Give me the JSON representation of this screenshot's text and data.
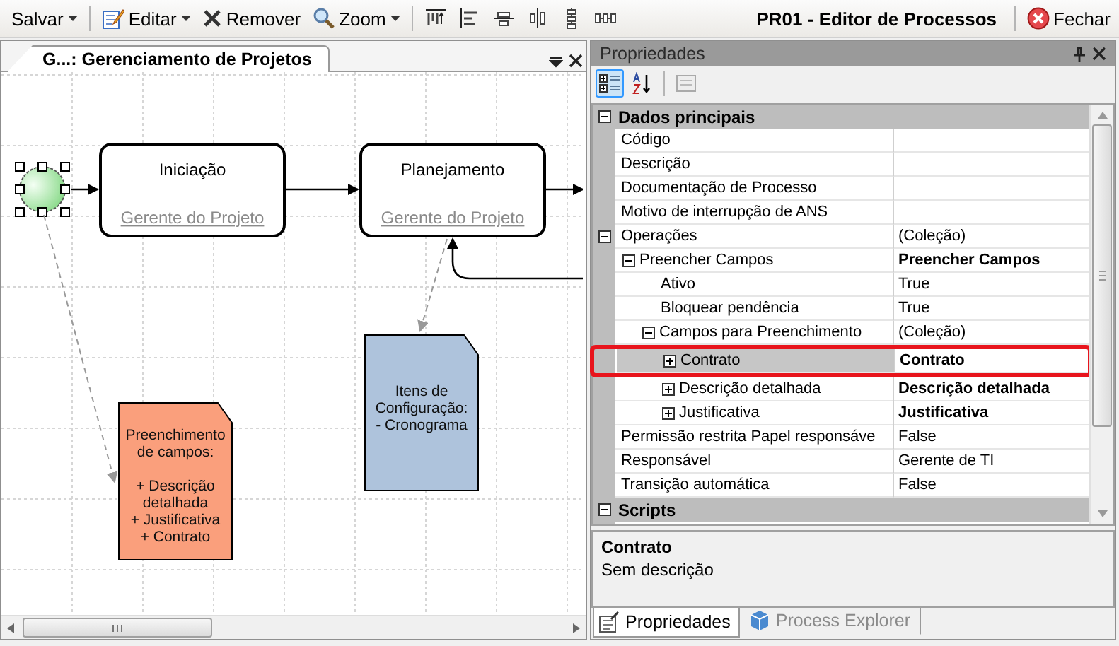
{
  "toolbar": {
    "items": [
      {
        "kind": "save",
        "label": "Salvar",
        "dropdown": true
      },
      {
        "kind": "edit",
        "label": "Editar",
        "dropdown": true
      },
      {
        "kind": "remove",
        "label": "Remover",
        "dropdown": false
      },
      {
        "kind": "zoom",
        "label": "Zoom",
        "dropdown": true
      }
    ]
  },
  "window": {
    "title": "PR01 - Editor de Processos",
    "close_label": "Fechar"
  },
  "document_tab": {
    "title": "G...: Gerenciamento de Projetos"
  },
  "diagram": {
    "start_event": {
      "selected": true
    },
    "tasks": [
      {
        "name": "Iniciação",
        "role": "Gerente do Projeto"
      },
      {
        "name": "Planejamento",
        "role": "Gerente do Projeto"
      }
    ],
    "notes": [
      {
        "color": "#fa9f7c",
        "paragraphs": [
          [
            "Preenchimento",
            "de campos:"
          ],
          [
            "+ Descrição",
            "detalhada",
            "+ Justificativa",
            "+ Contrato"
          ]
        ]
      },
      {
        "color": "#aec3dc",
        "paragraphs": [
          [
            "Itens de",
            "Configuração:",
            "- Cronograma"
          ]
        ]
      }
    ]
  },
  "properties": {
    "title": "Propriedades",
    "toolbar": [
      {
        "kind": "categorized",
        "selected": true
      },
      {
        "kind": "alphabetical",
        "selected": false
      },
      {
        "kind": "pages",
        "selected": false
      }
    ],
    "grid": [
      {
        "kind": "category",
        "name": "Dados principais",
        "expanded": true,
        "children": [
          {
            "name": "Código",
            "selected": false,
            "bold": false
          },
          {
            "name": "Descrição",
            "selected": false,
            "bold": false
          },
          {
            "name": "Documentação de Processo",
            "selected": false,
            "bold": false
          },
          {
            "name": "Motivo de interrupção de ANS",
            "selected": false,
            "bold": false
          },
          {
            "name": "Operações",
            "value": "(Coleção)",
            "selected": false,
            "bold": false,
            "expanded": true,
            "children": [
              {
                "name": "Preencher Campos",
                "value": "Preencher Campos",
                "selected": false,
                "bold": true,
                "expanded": true,
                "children": [
                  {
                    "name": "Ativo",
                    "value": "True",
                    "selected": false,
                    "bold": false
                  },
                  {
                    "name": "Bloquear pendência",
                    "value": "True",
                    "selected": false,
                    "bold": false
                  },
                  {
                    "name": "Campos para Preenchimento",
                    "value": "(Coleção)",
                    "selected": false,
                    "bold": false,
                    "expanded": true,
                    "children": [
                      {
                        "name": "Contrato",
                        "value": "Contrato",
                        "selected": true,
                        "bold": true,
                        "expanded": false,
                        "highlighted": true
                      },
                      {
                        "name": "Descrição detalhada",
                        "value": "Descrição detalhada",
                        "selected": false,
                        "bold": true,
                        "expanded": false,
                        "highlighted": false
                      },
                      {
                        "name": "Justificativa",
                        "value": "Justificativa",
                        "selected": false,
                        "bold": true,
                        "expanded": false,
                        "highlighted": false
                      }
                    ]
                  }
                ]
              }
            ]
          },
          {
            "name": "Permissão restrita Papel responsáve",
            "value": "False",
            "selected": false,
            "bold": false
          },
          {
            "name": "Responsável",
            "value": "Gerente de TI",
            "selected": false,
            "bold": false
          },
          {
            "name": "Transição automática",
            "value": "False",
            "selected": false,
            "bold": false
          }
        ]
      },
      {
        "kind": "category",
        "name": "Scripts",
        "expanded": true
      }
    ],
    "description": {
      "title": "Contrato",
      "text": "Sem descrição"
    },
    "tabs": [
      {
        "label": "Propriedades",
        "selected": true
      },
      {
        "label": "Process Explorer",
        "selected": false
      }
    ]
  }
}
